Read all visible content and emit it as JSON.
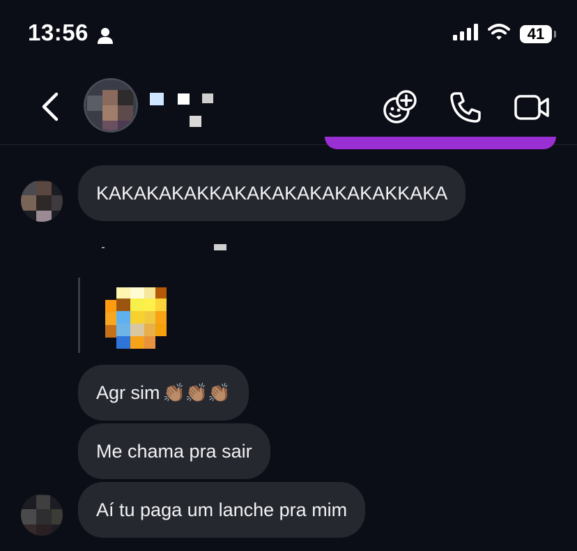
{
  "status_bar": {
    "time": "13:56",
    "battery_level": "41"
  },
  "header": {
    "contact_name": "",
    "actions": [
      "sticker-call",
      "audio-call",
      "video-call"
    ]
  },
  "messages": [
    {
      "type": "text",
      "from": "contact",
      "text": "KAKAKAKAKKAKAKAKAKAKAKAKKAKA",
      "show_avatar": true
    },
    {
      "type": "image",
      "from": "contact",
      "reply_label": ""
    },
    {
      "type": "text",
      "from": "contact",
      "text": "Agr sim",
      "emoji": "👏🏽👏🏽👏🏽"
    },
    {
      "type": "text",
      "from": "contact",
      "text": "Me chama pra sair"
    },
    {
      "type": "text",
      "from": "contact",
      "text": "Aí tu paga um lanche pra mim",
      "show_avatar": true
    }
  ],
  "colors": {
    "background": "#0c0e17",
    "received_bubble": "#262830",
    "sent_bubble": "#9a2fd4",
    "text": "#f2f2f4"
  },
  "icons": {
    "back": "chevron-left-icon",
    "sticker_call": "face-plus-icon",
    "call": "phone-icon",
    "video": "video-camera-icon"
  }
}
